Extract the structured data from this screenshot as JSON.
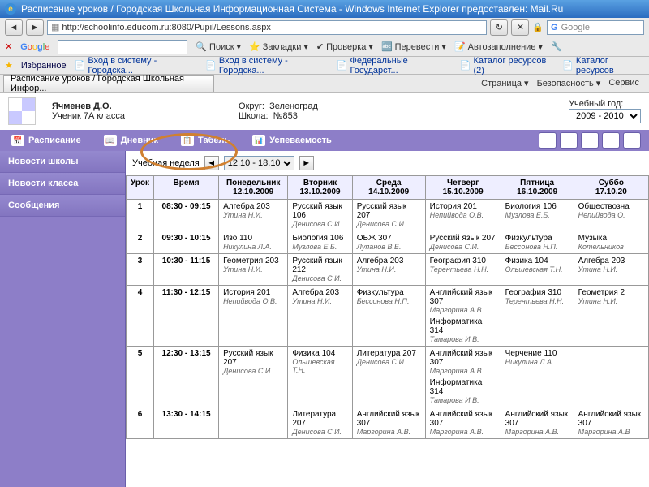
{
  "window": {
    "title": "Расписание уроков / Городская Школьная Информационная Система - Windows Internet Explorer предоставлен: Mail.Ru"
  },
  "address": {
    "url": "http://schoolinfo.educom.ru:8080/Pupil/Lessons.aspx",
    "search_placeholder": "Google",
    "lock": "🔒"
  },
  "gtool": {
    "label": "Google",
    "search_btn": "Поиск",
    "auto": "Автозаполнение",
    "check": "Проверка",
    "translate": "Перевести",
    "bookmarks": "Закладки"
  },
  "fav": {
    "label": "Избранное",
    "l1": "Вход в систему - Городска...",
    "l2": "Вход в систему - Городска...",
    "l3": "Федеральные Государст...",
    "l4": "Каталог ресурсов (2)",
    "l5": "Каталог ресурсов"
  },
  "tab": {
    "title": "Расписание уроков / Городская Школьная Инфор..."
  },
  "rlinks": {
    "a": "Страница ▾",
    "b": "Безопасность ▾",
    "c": "Сервис"
  },
  "student": {
    "name": "Ячменев Д.О.",
    "grade": "Ученик 7А класса"
  },
  "school": {
    "okrug_l": "Округ:",
    "okrug": "Зеленоград",
    "num_l": "Школа:",
    "num": "№853"
  },
  "year": {
    "label": "Учебный год:",
    "value": "2009 - 2010"
  },
  "nav": {
    "a": "Расписание",
    "b": "Дневник",
    "c": "Табель",
    "d": "Успеваемость"
  },
  "side": {
    "a": "Новости школы",
    "b": "Новости класса",
    "c": "Сообщения"
  },
  "week": {
    "label": "Учебная неделя",
    "range": "12.10 - 18.10"
  },
  "hdr": {
    "lesson": "Урок",
    "time": "Время",
    "d1a": "Понедельник",
    "d1b": "12.10.2009",
    "d2a": "Вторник",
    "d2b": "13.10.2009",
    "d3a": "Среда",
    "d3b": "14.10.2009",
    "d4a": "Четверг",
    "d4b": "15.10.2009",
    "d5a": "Пятница",
    "d5b": "16.10.2009",
    "d6a": "Суббо",
    "d6b": "17.10.20"
  },
  "rows": [
    {
      "n": "1",
      "t": "08:30 - 09:15",
      "c1s": "Алгебра 203",
      "c1t": "Утина Н.И.",
      "c2s": "Русский язык 106",
      "c2t": "Денисова С.И.",
      "c3s": "Русский язык 207",
      "c3t": "Денисова С.И.",
      "c4s": "История 201",
      "c4t": "Непийвода О.В.",
      "c5s": "Биология 106",
      "c5t": "Музлова Е.Б.",
      "c6s": "Обществозна",
      "c6t": "Непийвода О."
    },
    {
      "n": "2",
      "t": "09:30 - 10:15",
      "c1s": "Изо 110",
      "c1t": "Никулина Л.А.",
      "c2s": "Биология 106",
      "c2t": "Музлова Е.Б.",
      "c3s": "ОБЖ 307",
      "c3t": "Лупанов В.Е.",
      "c4s": "Русский язык 207",
      "c4t": "Денисова С.И.",
      "c5s": "Физкультура",
      "c5t": "Бессонова Н.П.",
      "c6s": "Музыка",
      "c6t": "Котельников"
    },
    {
      "n": "3",
      "t": "10:30 - 11:15",
      "c1s": "Геометрия 203",
      "c1t": "Утина Н.И.",
      "c2s": "Русский язык 212",
      "c2t": "Денисова С.И.",
      "c3s": "Алгебра 203",
      "c3t": "Утина Н.И.",
      "c4s": "География 310",
      "c4t": "Терентьева Н.Н.",
      "c5s": "Физика 104",
      "c5t": "Ольшевская Т.Н.",
      "c6s": "Алгебра 203",
      "c6t": "Утина Н.И."
    },
    {
      "n": "4",
      "t": "11:30 - 12:15",
      "c1s": "История 201",
      "c1t": "Непийвода О.В.",
      "c2s": "Алгебра 203",
      "c2t": "Утина Н.И.",
      "c3s": "Физкультура",
      "c3t": "Бессонова Н.П.",
      "c4s": "Английский язык 307",
      "c4t": "Маргорина А.В.",
      "c4s2": "Информатика 314",
      "c4t2": "Тамарова И.В.",
      "c5s": "География 310",
      "c5t": "Терентьева Н.Н.",
      "c6s": "Геометрия 2",
      "c6t": "Утина Н.И."
    },
    {
      "n": "5",
      "t": "12:30 - 13:15",
      "c1s": "Русский язык 207",
      "c1t": "Денисова С.И.",
      "c2s": "Физика 104",
      "c2t": "Ольшевская Т.Н.",
      "c3s": "Литература 207",
      "c3t": "Денисова С.И.",
      "c4s": "Английский язык 307",
      "c4t": "Маргорина А.В.",
      "c4s2": "Информатика 314",
      "c4t2": "Тамарова И.В.",
      "c5s": "Черчение 110",
      "c5t": "Никулина Л.А.",
      "c6s": "",
      "c6t": ""
    },
    {
      "n": "6",
      "t": "13:30 - 14:15",
      "c1s": "",
      "c1t": "",
      "c2s": "Литература 207",
      "c2t": "Денисова С.И.",
      "c3s": "Английский язык 307",
      "c3t": "Маргорина А.В.",
      "c4s": "Английский язык 307",
      "c4t": "Маргорина А.В.",
      "c5s": "Английский язык 307",
      "c5t": "Маргорина А.В.",
      "c6s": "Английский язык 307",
      "c6t": "Маргорина А.В"
    }
  ]
}
